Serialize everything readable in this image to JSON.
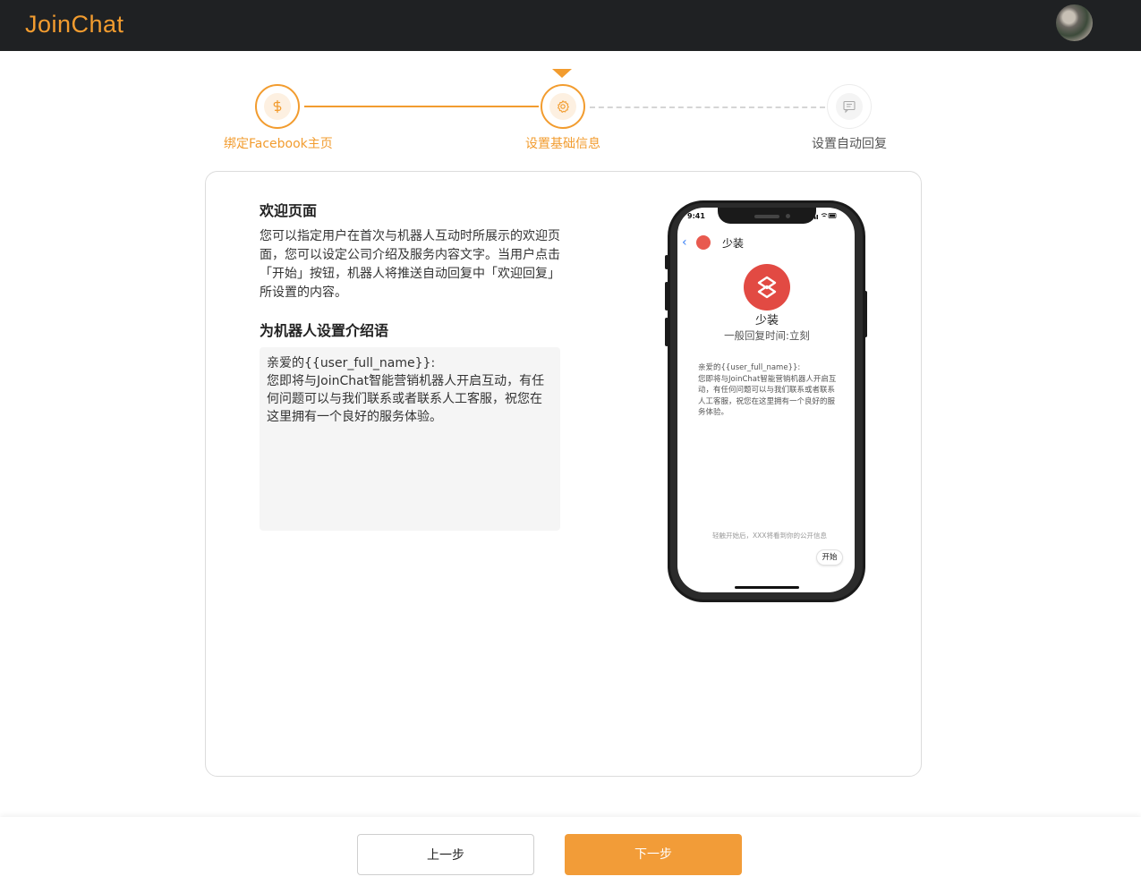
{
  "header": {
    "logo_text": "JoinChat",
    "brand_color": "#f29c2f",
    "avatar_icon": "user-avatar"
  },
  "stepper": {
    "steps": [
      {
        "label": "绑定Facebook主页",
        "icon": "dollar-link-icon",
        "state": "done"
      },
      {
        "label": "设置基础信息",
        "icon": "gear-icon",
        "state": "current"
      },
      {
        "label": "设置自动回复",
        "icon": "message-icon",
        "state": "todo"
      }
    ]
  },
  "welcome": {
    "title": "欢迎页面",
    "description": "您可以指定用户在首次与机器人互动时所展示的欢迎页面，您可以设定公司介绍及服务内容文字。当用户点击「开始」按钮，机器人将推送自动回复中「欢迎回复」所设置的内容。"
  },
  "intro": {
    "title": "为机器人设置介绍语",
    "value": "亲爱的{{user_full_name}}:\n您即将与JoinChat智能营销机器人开启互动，有任何问题可以与我们联系或者联系人工客服，祝您在这里拥有一个良好的服务体验。"
  },
  "phone_preview": {
    "time": "9:41",
    "back_icon": "chevron-left-icon",
    "page_name_top": "少装",
    "page_name": "少装",
    "reply_time": "一般回复时间:立刻",
    "message": "亲爱的{{user_full_name}}:\n您即将与JoinChat智能营销机器人开启互动，有任何问题可以与我们联系或者联系人工客服，祝您在这里拥有一个良好的服务体验。",
    "hint": "轻触开始后，XXX将看到你的公开信息",
    "start_button": "开始"
  },
  "footer": {
    "prev_label": "上一步",
    "next_label": "下一步",
    "next_color": "#f29c38"
  }
}
